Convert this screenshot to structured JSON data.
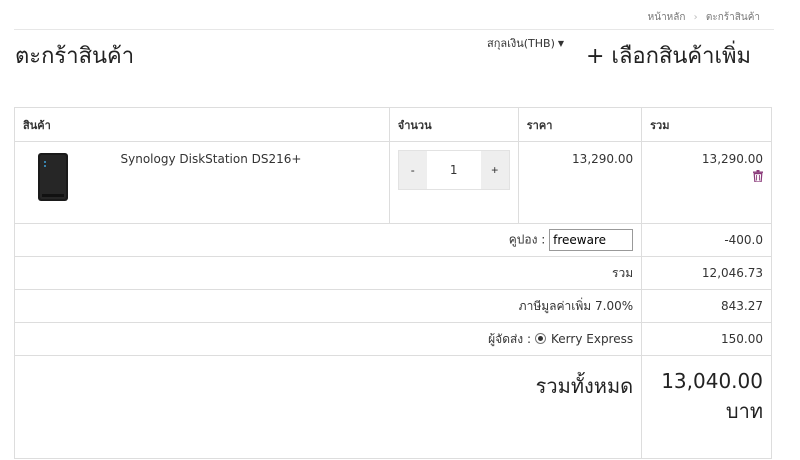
{
  "breadcrumb": {
    "home": "หน้าหลัก",
    "current": "ตะกร้าสินค้า"
  },
  "page_title": "ตะกร้าสินค้า",
  "currency_label": "สกุลเงิน(THB)",
  "add_more_label": "+ เลือกสินค้าเพิ่ม",
  "table": {
    "headers": {
      "product": "สินค้า",
      "qty": "จำนวน",
      "price": "ราคา",
      "total": "รวม"
    }
  },
  "items": [
    {
      "name": "Synology DiskStation DS216+",
      "qty": "1",
      "price": "13,290.00",
      "total": "13,290.00",
      "qty_minus": "-",
      "qty_plus": "+"
    }
  ],
  "coupon": {
    "label": "คูปอง :",
    "value": "freeware",
    "amount": "-400.0"
  },
  "subtotal": {
    "label": "รวม",
    "amount": "12,046.73"
  },
  "vat": {
    "label": "ภาษีมูลค่าเพิ่ม 7.00%",
    "amount": "843.27"
  },
  "shipping": {
    "label": "ผู้จัดส่ง :",
    "option": "Kerry Express",
    "amount": "150.00"
  },
  "grand_total": {
    "label": "รวมทั้งหมด",
    "amount": "13,040.00",
    "unit": "บาท"
  },
  "icons": {
    "remove": "trash-icon",
    "product": "nas-product-image"
  },
  "colors": {
    "border": "#dddddd",
    "qty_button_bg": "#eeeeee",
    "trash": "#8a3a7a"
  }
}
